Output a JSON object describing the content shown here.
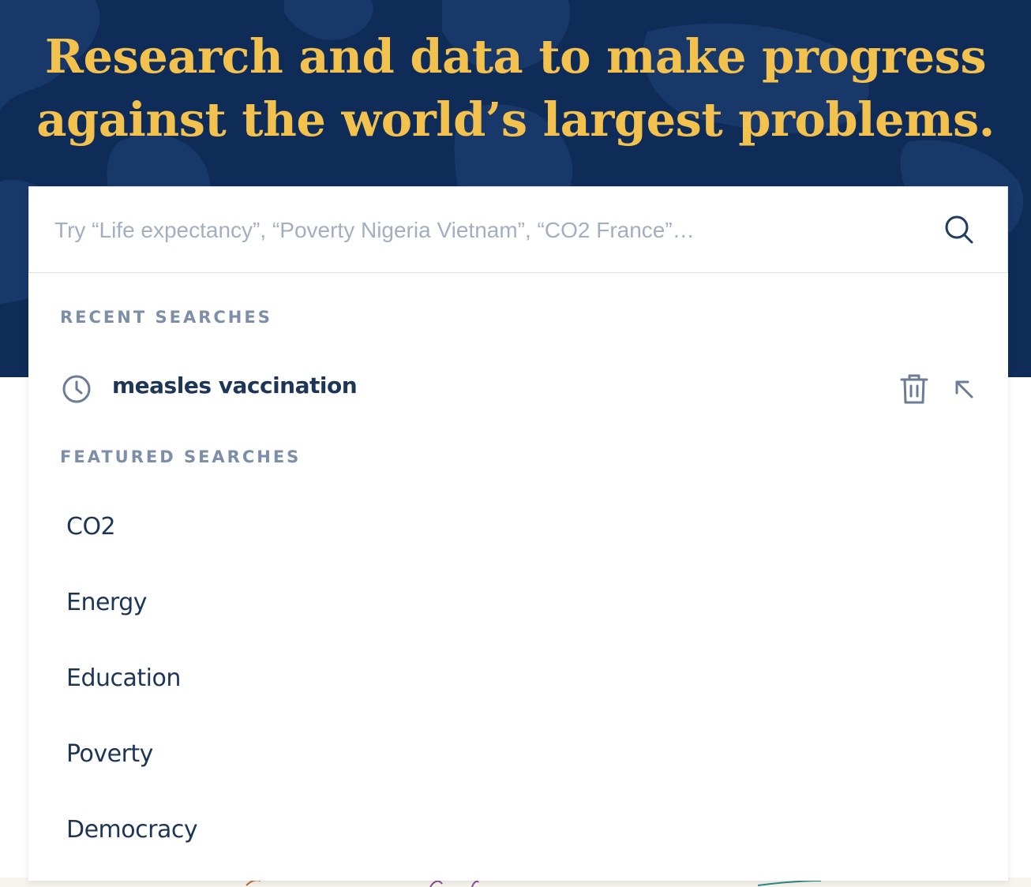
{
  "hero": {
    "title_line1": "Research and data to make progress",
    "title_line2": "against the world’s largest problems."
  },
  "search": {
    "placeholder": "Try “Life expectancy”, “Poverty Nigeria Vietnam”, “CO2 France”…",
    "value": ""
  },
  "recent": {
    "heading": "RECENT SEARCHES",
    "items": [
      {
        "label": "measles vaccination"
      }
    ]
  },
  "featured": {
    "heading": "FEATURED SEARCHES",
    "items": [
      {
        "label": "CO2"
      },
      {
        "label": "Energy"
      },
      {
        "label": "Education"
      },
      {
        "label": "Poverty"
      },
      {
        "label": "Democracy"
      }
    ]
  },
  "icons": {
    "search": "search-icon",
    "recent": "clock-icon",
    "delete": "trash-icon",
    "fill": "arrow-up-left-icon"
  },
  "colors": {
    "hero_background": "#0f2c59",
    "title": "#f2c14e",
    "section_label": "#7c8ea8",
    "text": "#1d3557",
    "icon": "#6b7d96"
  }
}
